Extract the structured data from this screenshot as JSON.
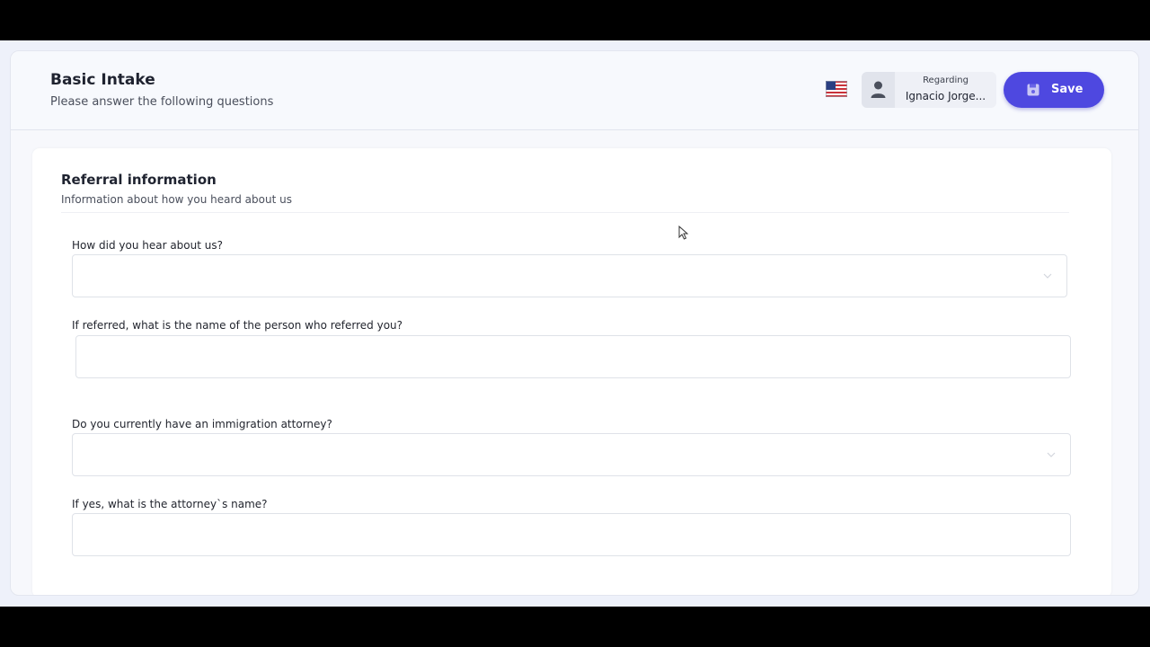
{
  "header": {
    "title": "Basic Intake",
    "subtitle": "Please answer the following questions",
    "language_icon": "us-flag-icon",
    "regarding": {
      "label": "Regarding",
      "name": "Ignacio Jorge..."
    },
    "save": {
      "label": "Save",
      "icon": "save-icon"
    }
  },
  "section": {
    "title": "Referral information",
    "description": "Information about how you heard about us"
  },
  "fields": [
    {
      "label": "How did you hear about us?",
      "type": "select",
      "value": ""
    },
    {
      "label": "If referred, what is the name of the person who referred you?",
      "type": "text",
      "value": ""
    },
    {
      "label": "Do you currently have an immigration attorney?",
      "type": "select",
      "value": ""
    },
    {
      "label": "If yes, what is the attorney`s name?",
      "type": "text",
      "value": ""
    }
  ],
  "colors": {
    "primary": "#4e48e0",
    "background": "#eef1fa",
    "card": "#ffffff",
    "border": "#dfe2e8"
  }
}
